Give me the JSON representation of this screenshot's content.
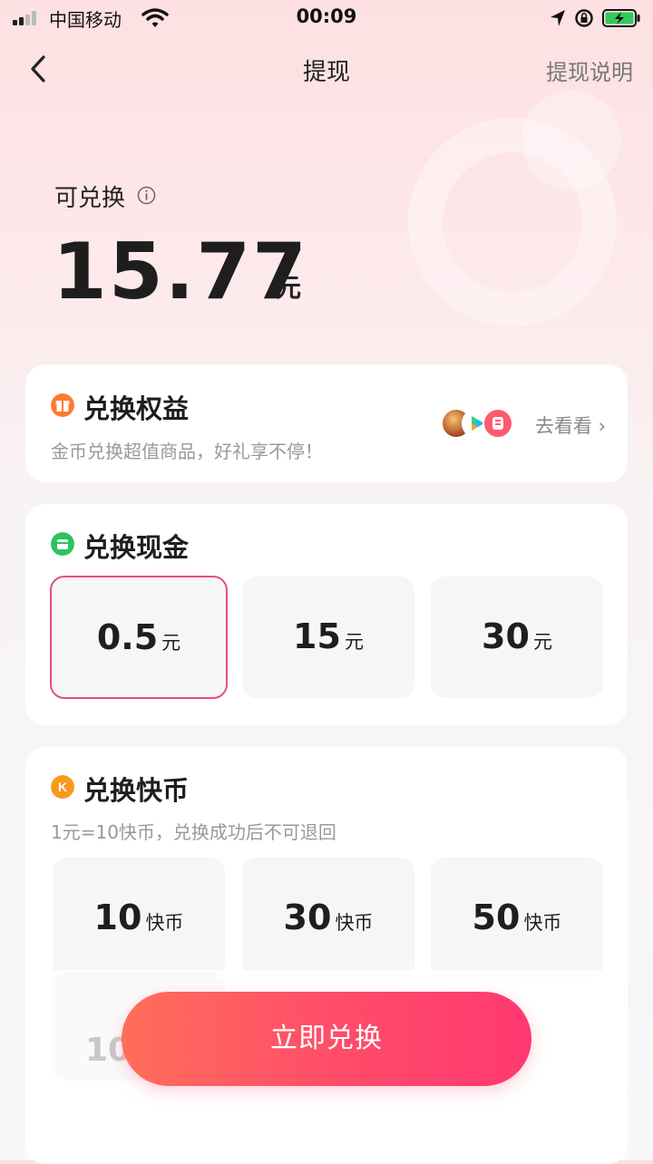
{
  "status_bar": {
    "carrier": "中国移动",
    "time": "00:09"
  },
  "nav": {
    "title": "提现",
    "right_link": "提现说明"
  },
  "balance": {
    "label": "可兑换",
    "amount": "15.77",
    "unit": "元"
  },
  "benefits": {
    "title": "兑换权益",
    "subtitle": "金币兑换超值商品，好礼享不停！",
    "link": "去看看 ›"
  },
  "cash": {
    "title": "兑换现金",
    "options": [
      {
        "value": "0.5",
        "unit": "元",
        "selected": true
      },
      {
        "value": "15",
        "unit": "元",
        "selected": false
      },
      {
        "value": "30",
        "unit": "元",
        "selected": false
      }
    ]
  },
  "coins": {
    "title": "兑换快币",
    "subtitle": "1元=10快币，兑换成功后不可退回",
    "options": [
      {
        "value": "10",
        "unit": "快币"
      },
      {
        "value": "30",
        "unit": "快币"
      },
      {
        "value": "50",
        "unit": "快币"
      }
    ],
    "partial_value": "10"
  },
  "action_button": "立即兑换",
  "colors": {
    "accent": "#ff4b6a",
    "selected_border": "#e6507a",
    "orange": "#ff7a2e",
    "green": "#2ec25e",
    "coin": "#f79a1c"
  }
}
